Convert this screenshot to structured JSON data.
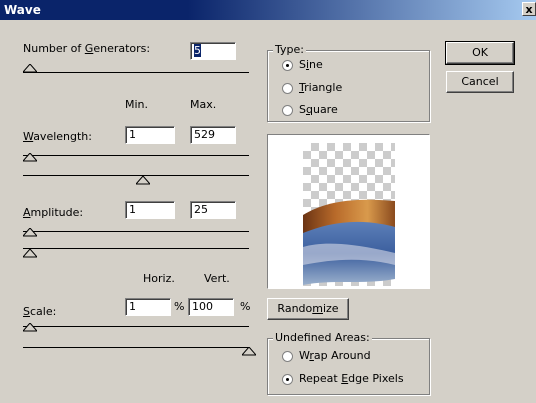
{
  "window": {
    "title": "Wave",
    "close_glyph": "x"
  },
  "generators": {
    "label_pre": "Number of ",
    "label_u": "G",
    "label_post": "enerators:",
    "value": "5"
  },
  "columns": {
    "min": "Min.",
    "max": "Max.",
    "horiz": "Horiz.",
    "vert": "Vert."
  },
  "wavelength": {
    "label_u": "W",
    "label_post": "avelength:",
    "min": "1",
    "max": "529"
  },
  "amplitude": {
    "label_u": "A",
    "label_post": "mplitude:",
    "min": "1",
    "max": "25"
  },
  "scale": {
    "label_u": "S",
    "label_post": "cale:",
    "horiz": "1",
    "vert": "100",
    "unit": "%"
  },
  "type": {
    "title": "Type:",
    "options": [
      {
        "pre": "S",
        "u": "i",
        "post": "ne",
        "selected": true
      },
      {
        "pre": "",
        "u": "T",
        "post": "riangle",
        "selected": false
      },
      {
        "pre": "S",
        "u": "q",
        "post": "uare",
        "selected": false
      }
    ]
  },
  "buttons": {
    "ok": "OK",
    "cancel": "Cancel",
    "randomize_pre": "Rando",
    "randomize_u": "m",
    "randomize_post": "ize"
  },
  "undefined_areas": {
    "title": "Undefined Areas:",
    "options": [
      {
        "pre": "W",
        "u": "r",
        "post": "ap Around",
        "selected": false
      },
      {
        "pre": "Repeat ",
        "u": "E",
        "post": "dge Pixels",
        "selected": true
      }
    ]
  },
  "colors": {
    "titlebar": "#0a246a",
    "face": "#d4d0c8"
  }
}
